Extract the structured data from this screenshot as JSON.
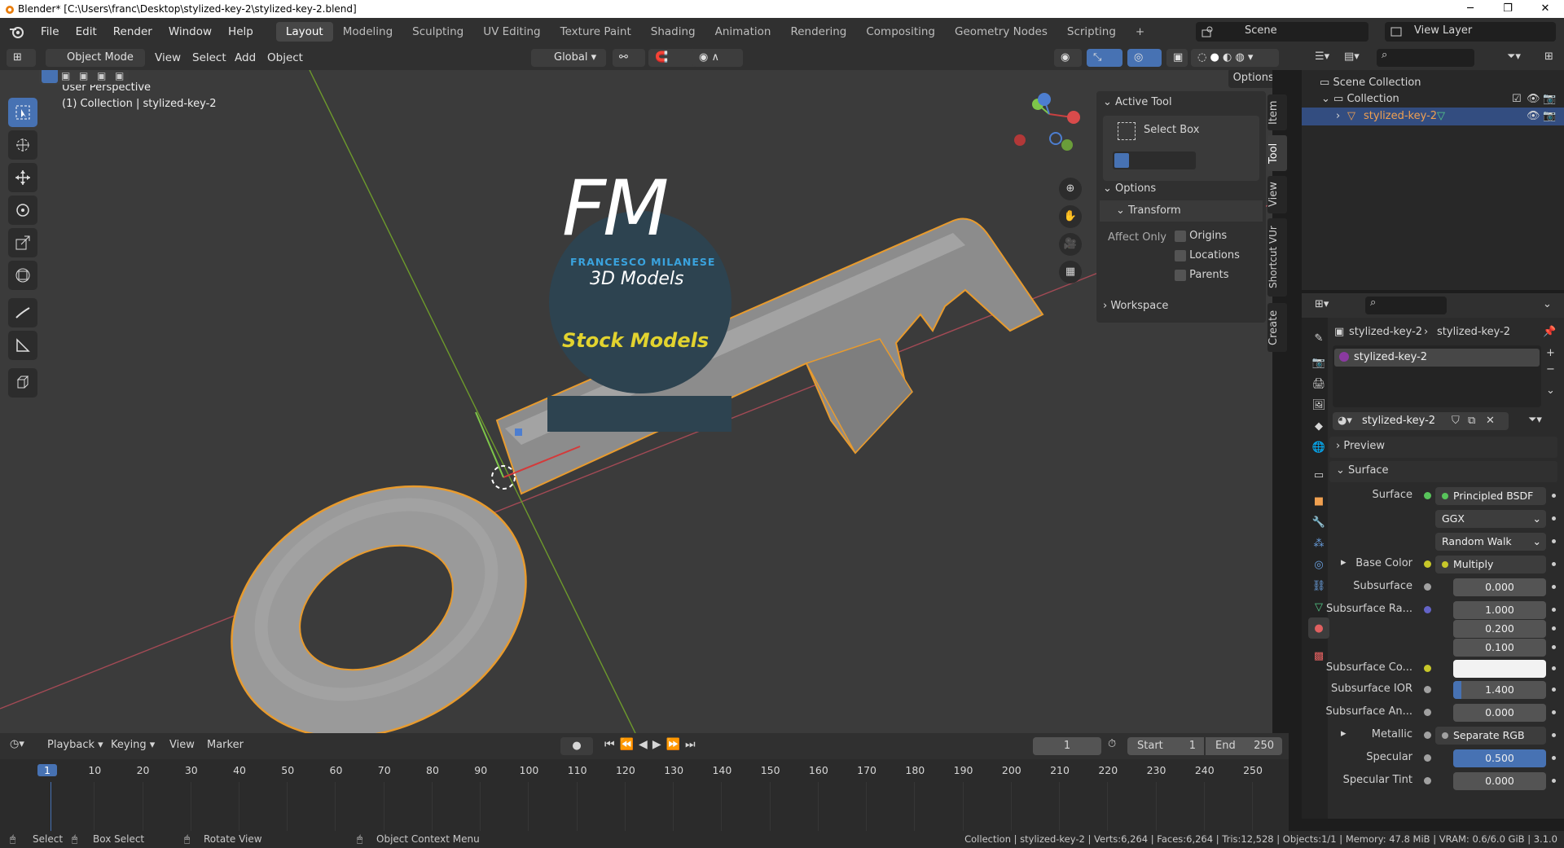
{
  "titlebar": {
    "title": "Blender* [C:\\Users\\franc\\Desktop\\stylized-key-2\\stylized-key-2.blend]"
  },
  "menu": {
    "file": "File",
    "edit": "Edit",
    "render": "Render",
    "window": "Window",
    "help": "Help"
  },
  "workspaces": [
    "Layout",
    "Modeling",
    "Sculpting",
    "UV Editing",
    "Texture Paint",
    "Shading",
    "Animation",
    "Rendering",
    "Compositing",
    "Geometry Nodes",
    "Scripting"
  ],
  "scene": {
    "label": "Scene",
    "view_layer": "View Layer"
  },
  "viewport_header": {
    "mode": "Object Mode",
    "view": "View",
    "select": "Select",
    "add": "Add",
    "object": "Object",
    "orientation": "Global",
    "options": "Options"
  },
  "viewport": {
    "perspective": "User Perspective",
    "collection_info": "(1) Collection | stylized-key-2"
  },
  "watermark": {
    "logo": "FM",
    "brand": "FRANCESCO MILANESE",
    "sub": "3D Models",
    "banner": "Stock Models"
  },
  "npanel": {
    "active_tool": "Active Tool",
    "tool_name": "Select Box",
    "options": "Options",
    "transform": "Transform",
    "affect_only": "Affect Only",
    "origins": "Origins",
    "locations": "Locations",
    "parents": "Parents",
    "workspace": "Workspace"
  },
  "vtabs": [
    "Item",
    "Tool",
    "View",
    "Shortcut VUr",
    "Create"
  ],
  "outliner": {
    "scene_collection": "Scene Collection",
    "collection": "Collection",
    "object": "stylized-key-2"
  },
  "properties": {
    "breadcrumb_obj": "stylized-key-2",
    "breadcrumb_mat": "stylized-key-2",
    "slot": "stylized-key-2",
    "material_name": "stylized-key-2",
    "preview": "Preview",
    "surface_section": "Surface",
    "rows": [
      {
        "label": "Surface",
        "value": "Principled BSDF",
        "kind": "node",
        "sock": "#58c45b"
      },
      {
        "label": "",
        "value": "GGX",
        "kind": "dropdown"
      },
      {
        "label": "",
        "value": "Random Walk",
        "kind": "dropdown"
      },
      {
        "label": "Base Color",
        "value": "Multiply",
        "kind": "node",
        "sock": "#c7c729",
        "expand": true
      },
      {
        "label": "Subsurface",
        "value": "0.000",
        "kind": "num",
        "sock": "#a1a1a1"
      },
      {
        "label": "Subsurface Ra...",
        "value": "1.000",
        "kind": "num",
        "sock": "#6363c7"
      },
      {
        "label": "",
        "value": "0.200",
        "kind": "num"
      },
      {
        "label": "",
        "value": "0.100",
        "kind": "num"
      },
      {
        "label": "Subsurface Co...",
        "value": "",
        "kind": "color",
        "sock": "#c7c729"
      },
      {
        "label": "Subsurface IOR",
        "value": "1.400",
        "kind": "numbar",
        "sock": "#a1a1a1"
      },
      {
        "label": "Subsurface An...",
        "value": "0.000",
        "kind": "num",
        "sock": "#a1a1a1"
      },
      {
        "label": "Metallic",
        "value": "Separate RGB",
        "kind": "node",
        "sock": "#a1a1a1",
        "expand": true
      },
      {
        "label": "Specular",
        "value": "0.500",
        "kind": "numblue",
        "sock": "#a1a1a1"
      },
      {
        "label": "Specular Tint",
        "value": "0.000",
        "kind": "num",
        "sock": "#a1a1a1"
      }
    ]
  },
  "timeline": {
    "playback": "Playback",
    "keying": "Keying",
    "view": "View",
    "marker": "Marker",
    "current_frame": "1",
    "start_label": "Start",
    "start": "1",
    "end_label": "End",
    "end": "250",
    "ticks": [
      "1",
      "10",
      "20",
      "30",
      "40",
      "50",
      "60",
      "70",
      "80",
      "90",
      "100",
      "110",
      "120",
      "130",
      "140",
      "150",
      "160",
      "170",
      "180",
      "190",
      "200",
      "210",
      "220",
      "230",
      "240",
      "250"
    ]
  },
  "status": {
    "select": "Select",
    "box_select": "Box Select",
    "rotate": "Rotate View",
    "context": "Object Context Menu",
    "stats": "Collection | stylized-key-2 | Verts:6,264 | Faces:6,264 | Tris:12,528 | Objects:1/1 | Memory: 47.8 MiB | VRAM: 0.6/6.0 GiB | 3.1.0"
  }
}
